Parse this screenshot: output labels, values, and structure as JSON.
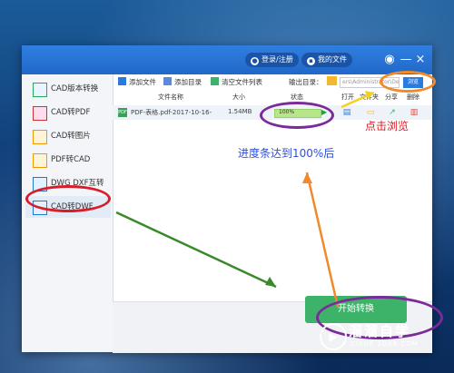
{
  "titlebar": {
    "login_label": "登录/注册",
    "my_files_label": "我的文件",
    "minimize_label": "—",
    "close_label": "×"
  },
  "sidebar": {
    "items": [
      {
        "label": "CAD版本转换",
        "icon": "cad-version-icon"
      },
      {
        "label": "CAD转PDF",
        "icon": "cad-pdf-icon"
      },
      {
        "label": "CAD转图片",
        "icon": "cad-image-icon"
      },
      {
        "label": "PDF转CAD",
        "icon": "pdf-cad-icon"
      },
      {
        "label": "DWG DXF互转",
        "icon": "dwg-dxf-icon"
      },
      {
        "label": "CAD转DWF",
        "icon": "cad-dwf-icon"
      }
    ],
    "active_index": 5
  },
  "toolbar": {
    "add_file": "添加文件",
    "add_dir": "添加目录",
    "clear_list": "清空文件列表",
    "output_dir_label": "输出目录：",
    "output_path": "ers\\Administrator\\Desktop",
    "browse": "浏览"
  },
  "table": {
    "headers": {
      "name": "文件名称",
      "size": "大小",
      "status": "状态",
      "open": "打开",
      "folder": "文件夹",
      "share": "分享",
      "delete": "删除"
    },
    "rows": [
      {
        "name": "PDF-表格.pdf-2017-10-16-",
        "size": "1.54MB",
        "progress_text": "100%",
        "progress": 1.0
      }
    ]
  },
  "convert_button": "开始转换",
  "annotations": {
    "browse_hint": "点击浏览",
    "progress_hint": "进度条达到100%后"
  },
  "watermark": {
    "title": "溜溜自学",
    "subtitle": "ZIXUE.3D66.COM"
  },
  "colors": {
    "accent": "#2a7ae0",
    "green": "#3db36a",
    "annot_purple": "#7b2a9a",
    "annot_orange": "#f08a2a",
    "annot_red": "#d81c2a",
    "annot_blue": "#2f4fd8"
  }
}
